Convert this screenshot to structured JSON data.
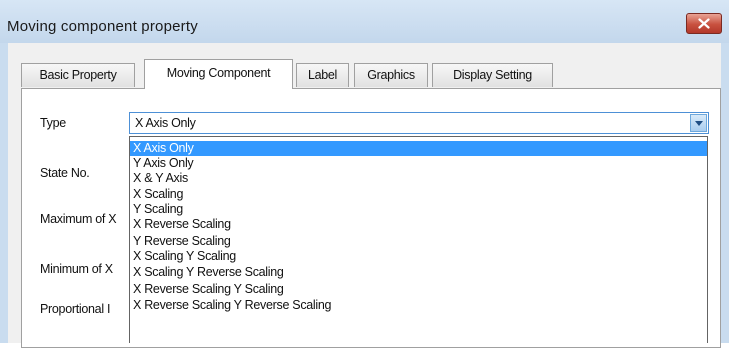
{
  "window": {
    "title": "Moving component property",
    "close_icon": "close-icon",
    "accent_close": "#c8513f",
    "highlight_color": "#3399ff"
  },
  "tabs": [
    {
      "label": "Basic Property",
      "selected": false
    },
    {
      "label": "Moving Component",
      "selected": true
    },
    {
      "label": "Label",
      "selected": false
    },
    {
      "label": "Graphics",
      "selected": false
    },
    {
      "label": "Display Setting",
      "selected": false
    }
  ],
  "form": {
    "type_label": "Type",
    "state_label": "State No.",
    "max_label": "Maximum of X",
    "min_label": "Minimum of X",
    "proportional_label": "Proportional I"
  },
  "type_combo": {
    "value": "X Axis Only",
    "arrow_icon": "chevron-down-icon"
  },
  "type_options": [
    "X Axis Only",
    "Y Axis Only",
    "X & Y Axis",
    "X Scaling",
    "Y Scaling",
    "X Reverse Scaling",
    "Y Reverse Scaling",
    "X Scaling Y Scaling",
    "X Scaling Y Reverse Scaling",
    "X Reverse Scaling Y Scaling",
    "X Reverse Scaling Y Reverse Scaling"
  ],
  "highlighted_option": "X Axis Only"
}
